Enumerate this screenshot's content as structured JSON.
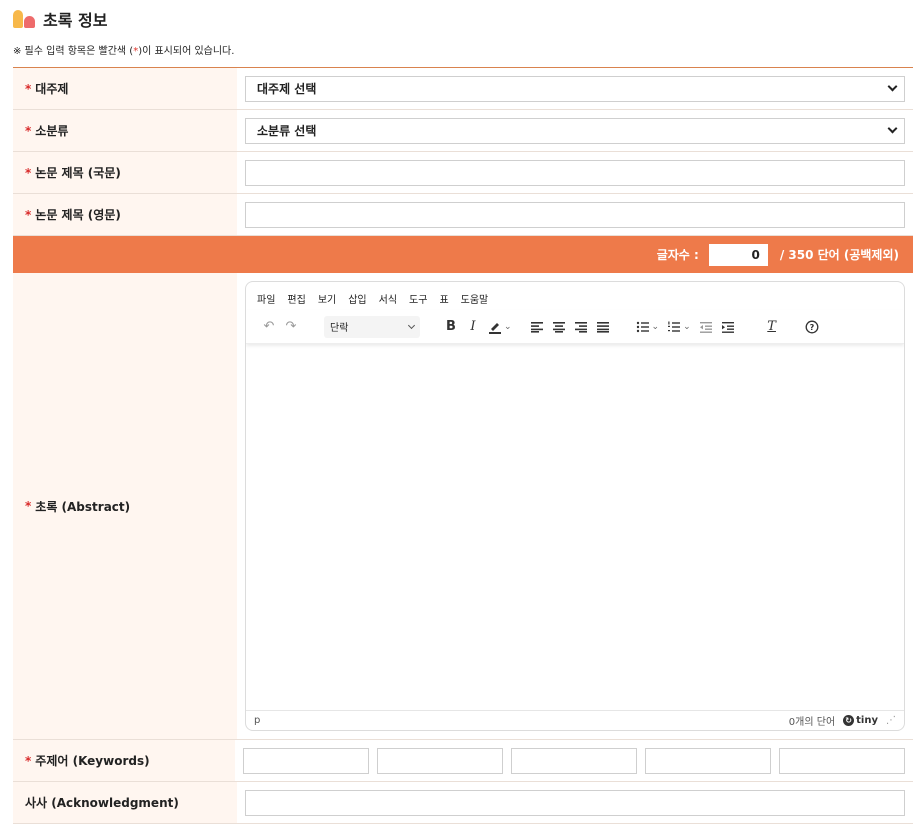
{
  "section": {
    "title": "초록 정보"
  },
  "notice": {
    "before": "※ 필수 입력 항목은 빨간색 (",
    "mark": "*",
    "after": ")이 표시되어 있습니다."
  },
  "fields": {
    "category": {
      "label": "대주제",
      "value": "대주제 선택"
    },
    "subcategory": {
      "label": "소분류",
      "value": "소분류 선택"
    },
    "title_ko": {
      "label": "논문 제목 (국문)",
      "value": ""
    },
    "title_en": {
      "label": "논문 제목 (영문)",
      "value": ""
    },
    "abstract": {
      "label": "초록 (Abstract)"
    },
    "keywords": {
      "label": "주제어 (Keywords)",
      "values": [
        "",
        "",
        "",
        "",
        ""
      ]
    },
    "acknowledgment": {
      "label": "사사 (Acknowledgment)",
      "value": ""
    }
  },
  "word_count": {
    "label": "글자수 :",
    "value": "0",
    "limit": "/ 350 단어 (공백제외)"
  },
  "editor": {
    "menu": [
      "파일",
      "편집",
      "보기",
      "삽입",
      "서식",
      "도구",
      "표",
      "도움말"
    ],
    "block_format": "단락",
    "status_path": "p",
    "status_words": "0개의 단어",
    "brand": "tiny"
  },
  "colors": {
    "accent": "#ee7a4a",
    "label_bg": "#fff6f0",
    "required": "#d92b2b"
  }
}
